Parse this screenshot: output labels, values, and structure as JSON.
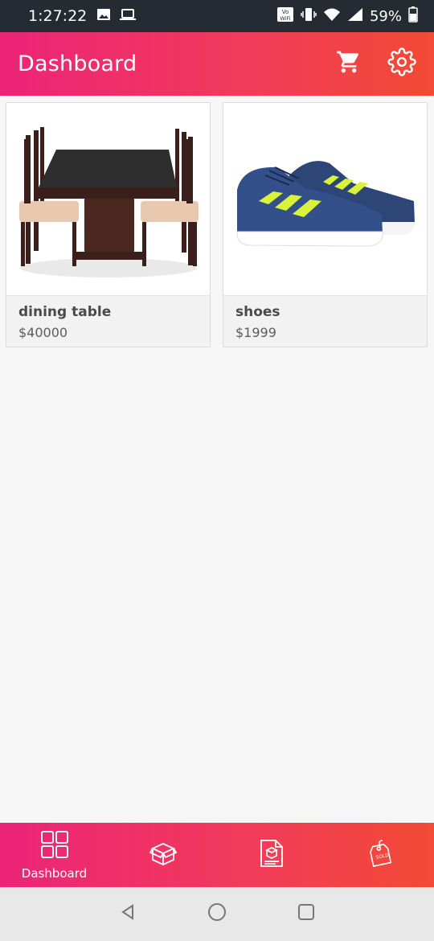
{
  "status_bar": {
    "time": "1:27:22",
    "battery": "59%",
    "wifi_badge": "VoWiFi"
  },
  "app_bar": {
    "title": "Dashboard"
  },
  "products": [
    {
      "name": "dining table",
      "price": "$40000",
      "image": "dining-table-image"
    },
    {
      "name": "shoes",
      "price": "$1999",
      "image": "shoes-image"
    }
  ],
  "bottom_nav": {
    "items": [
      {
        "label": "Dashboard",
        "icon": "dashboard-icon",
        "active": true
      },
      {
        "label": "",
        "icon": "products-box-icon"
      },
      {
        "label": "",
        "icon": "orders-icon"
      },
      {
        "label": "",
        "icon": "sold-tag-icon"
      }
    ]
  },
  "colors": {
    "gradient_start": "#ec2478",
    "gradient_end": "#f24a34",
    "status_bar": "#262a33",
    "background": "#f6f6f6"
  }
}
